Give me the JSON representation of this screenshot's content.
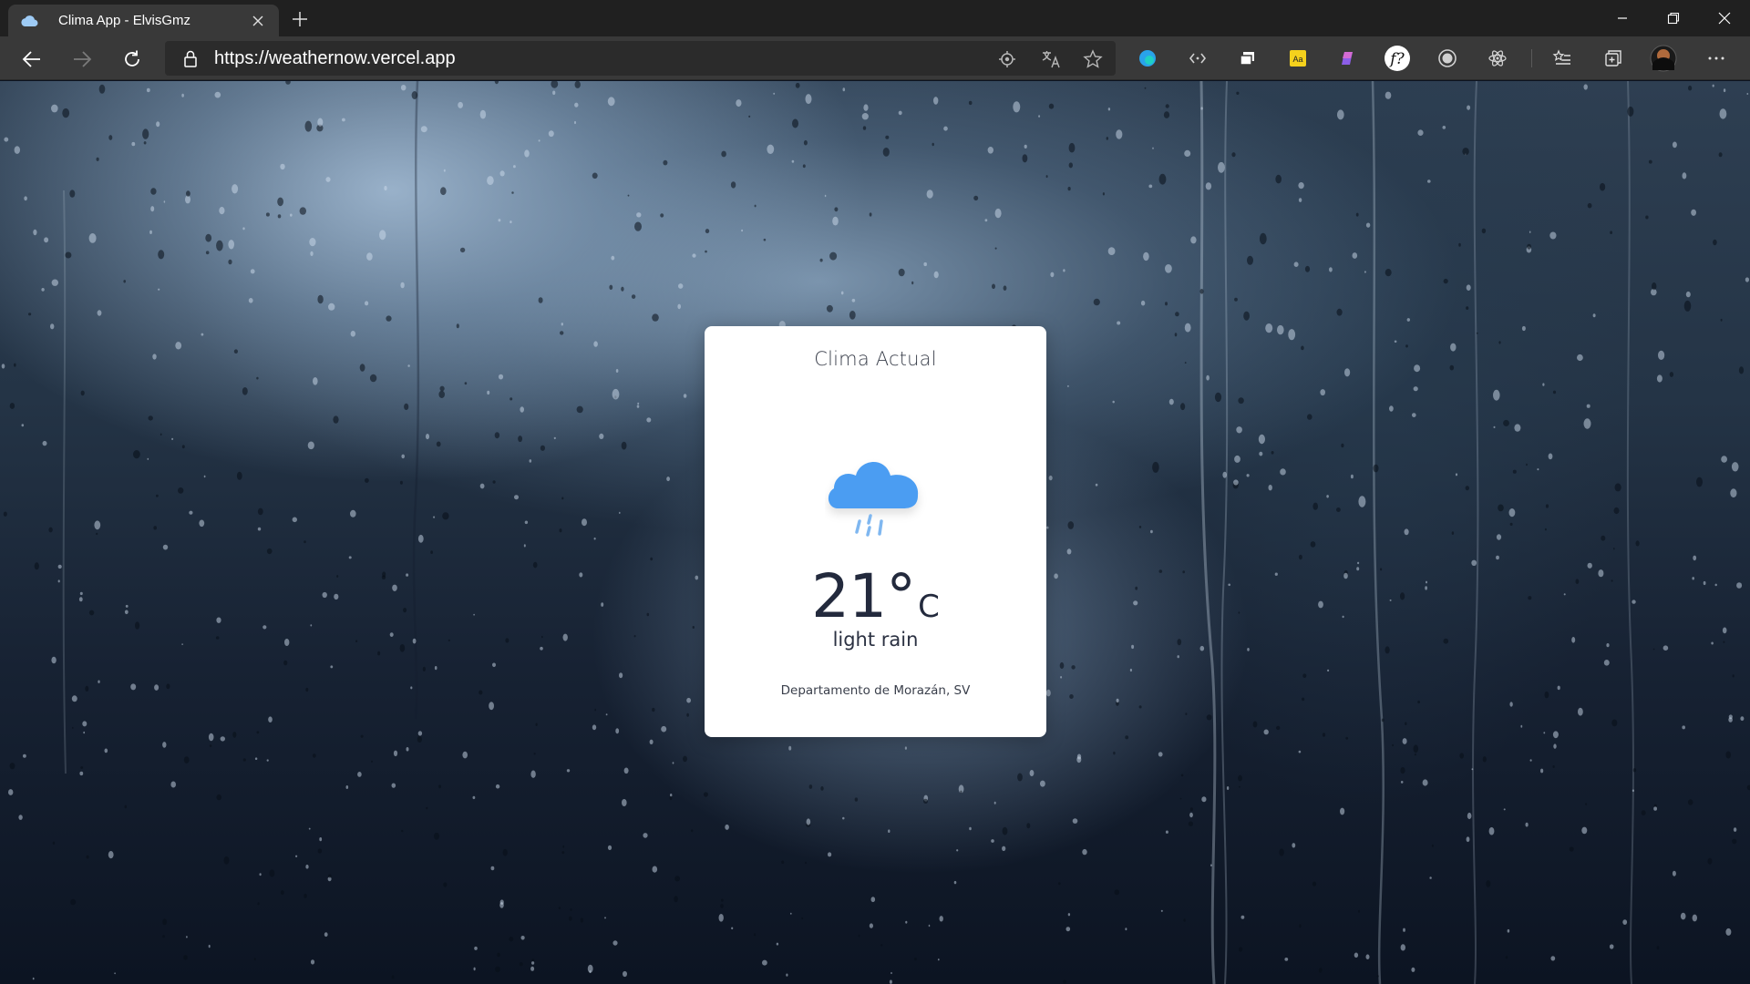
{
  "browser": {
    "tab_title": "Clima App - ElvisGmz",
    "url": "https://weathernow.vercel.app"
  },
  "extensions": [
    "edge-browser-icon",
    "code-icon",
    "window-icon",
    "dictionary-icon",
    "copilot-icon",
    "font-finder-icon",
    "record-icon",
    "atom-icon"
  ],
  "card": {
    "title": "Clima Actual",
    "icon": "rain-cloud-icon",
    "temperature": "21",
    "degree_symbol": "°",
    "unit": "C",
    "description": "light rain",
    "location": "Departamento de Morazán, SV"
  },
  "colors": {
    "cloud": "#4b9df2",
    "rain": "#7fb7f0",
    "card_bg": "#ffffff",
    "text_dark": "#232a3d"
  }
}
